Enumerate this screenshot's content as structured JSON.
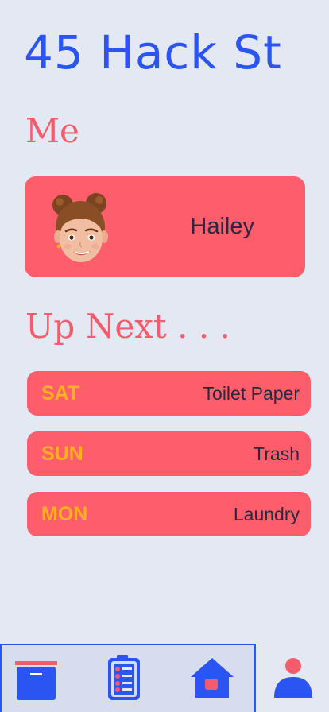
{
  "header": {
    "address": "45 Hack St"
  },
  "me_section": {
    "title": "Me",
    "profile": {
      "name": "Hailey",
      "avatar_icon": "memoji-avatar"
    }
  },
  "up_next_section": {
    "title": "Up Next . . .",
    "chores": [
      {
        "day": "SAT",
        "task": "Toilet Paper"
      },
      {
        "day": "SUN",
        "task": "Trash"
      },
      {
        "day": "MON",
        "task": "Laundry"
      }
    ]
  },
  "tab_bar": {
    "tabs": [
      {
        "icon": "box-icon"
      },
      {
        "icon": "checklist-icon"
      },
      {
        "icon": "home-icon"
      },
      {
        "icon": "person-icon",
        "active": true
      }
    ]
  },
  "colors": {
    "background": "#e4e8f3",
    "accent_blue": "#2b55f2",
    "accent_coral": "#fe5d6c",
    "day_yellow": "#ffb020",
    "text_dark": "#2a2840"
  }
}
